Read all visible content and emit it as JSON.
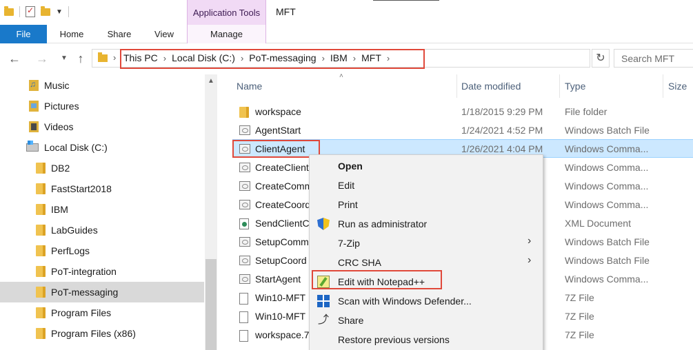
{
  "window": {
    "title": "MFT",
    "context_tab_group": "Application Tools"
  },
  "ribbon": {
    "tabs": [
      "File",
      "Home",
      "Share",
      "View",
      "Manage"
    ]
  },
  "address": {
    "crumbs": [
      "This PC",
      "Local Disk (C:)",
      "PoT-messaging",
      "IBM",
      "MFT"
    ],
    "search_placeholder": "Search MFT"
  },
  "nav_pane": {
    "items": [
      {
        "label": "Music",
        "icon": "music-folder-icon"
      },
      {
        "label": "Pictures",
        "icon": "pictures-folder-icon"
      },
      {
        "label": "Videos",
        "icon": "videos-folder-icon"
      },
      {
        "label": "Local Disk (C:)",
        "icon": "drive-icon"
      },
      {
        "label": "DB2",
        "icon": "folder-icon"
      },
      {
        "label": "FastStart2018",
        "icon": "folder-icon"
      },
      {
        "label": "IBM",
        "icon": "folder-icon"
      },
      {
        "label": "LabGuides",
        "icon": "folder-icon"
      },
      {
        "label": "PerfLogs",
        "icon": "folder-icon"
      },
      {
        "label": "PoT-integration",
        "icon": "folder-icon"
      },
      {
        "label": "PoT-messaging",
        "icon": "folder-icon",
        "selected": true
      },
      {
        "label": "Program Files",
        "icon": "folder-icon"
      },
      {
        "label": "Program Files (x86)",
        "icon": "folder-icon"
      }
    ]
  },
  "file_list": {
    "columns": [
      "Name",
      "Date modified",
      "Type",
      "Size"
    ],
    "rows": [
      {
        "name": "workspace",
        "date": "1/18/2015 9:29 PM",
        "type": "File folder",
        "icon": "folder-icon"
      },
      {
        "name": "AgentStart",
        "date": "1/24/2021 4:52 PM",
        "type": "Windows Batch File",
        "icon": "batch-file-icon"
      },
      {
        "name": "ClientAgent",
        "date": "1/26/2021 4:04 PM",
        "type": "Windows Comma...",
        "icon": "batch-file-icon",
        "selected": true
      },
      {
        "name": "CreateClient",
        "date": "",
        "type": "Windows Comma...",
        "icon": "batch-file-icon"
      },
      {
        "name": "CreateComm",
        "date": "",
        "type": "Windows Comma...",
        "icon": "batch-file-icon"
      },
      {
        "name": "CreateCoord",
        "date": "",
        "type": "Windows Comma...",
        "icon": "batch-file-icon"
      },
      {
        "name": "SendClientC",
        "date": "",
        "type": "XML Document",
        "icon": "xml-file-icon"
      },
      {
        "name": "SetupComm",
        "date": "",
        "type": "Windows Batch File",
        "icon": "batch-file-icon"
      },
      {
        "name": "SetupCoord",
        "date": "",
        "type": "Windows Batch File",
        "icon": "batch-file-icon"
      },
      {
        "name": "StartAgent",
        "date": "",
        "type": "Windows Comma...",
        "icon": "batch-file-icon"
      },
      {
        "name": "Win10-MFT",
        "date": "",
        "type": "7Z File",
        "icon": "document-icon"
      },
      {
        "name": "Win10-MFT",
        "date": "",
        "type": "7Z File",
        "icon": "document-icon"
      },
      {
        "name": "workspace.7",
        "date": "",
        "type": "7Z File",
        "icon": "document-icon"
      }
    ]
  },
  "context_menu": {
    "items": [
      {
        "label": "Open",
        "bold": true
      },
      {
        "label": "Edit"
      },
      {
        "label": "Print"
      },
      {
        "label": "Run as administrator",
        "icon": "uac-shield-icon"
      },
      {
        "label": "7-Zip",
        "submenu": true
      },
      {
        "label": "CRC SHA",
        "submenu": true
      },
      {
        "label": "Edit with Notepad++",
        "icon": "notepad-plus-plus-icon"
      },
      {
        "label": "Scan with Windows Defender...",
        "icon": "windows-defender-icon"
      },
      {
        "label": "Share",
        "icon": "share-icon"
      },
      {
        "label": "Restore previous versions"
      }
    ]
  },
  "colors": {
    "file_tab": "#1979ca",
    "app_tools": "#f1daf5",
    "selection": "#cce8ff",
    "highlight_box": "#e0483a"
  }
}
